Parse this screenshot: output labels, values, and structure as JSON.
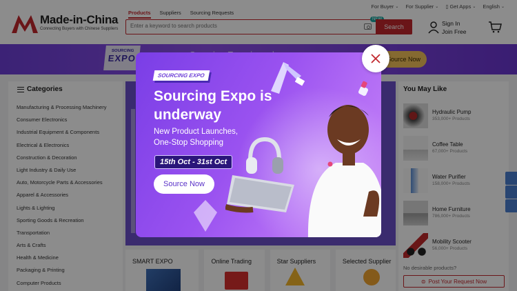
{
  "header": {
    "logo_title": "Made-in-China",
    "logo_subtitle": "Connecting Buyers with Chinese Suppliers",
    "topnav": [
      "For Buyer",
      "For Supplier",
      "Get Apps",
      "English"
    ],
    "search_tabs": [
      "Products",
      "Suppliers",
      "Sourcing Requests"
    ],
    "search_placeholder": "Enter a keyword to search products",
    "new_badge": "NEW",
    "search_button": "Search",
    "sign_in": "Sign In",
    "join_free": "Join Free",
    "brand_color": "#c1272d"
  },
  "banner": {
    "expo_logo_top": "SOURCING",
    "expo_logo_bottom": "EXPO",
    "title": "Sourcing Expo is underway",
    "cta": "Source Now"
  },
  "categories": {
    "title": "Categories",
    "items": [
      "Manufacturing & Processing Machinery",
      "Consumer Electronics",
      "Industrial Equipment & Components",
      "Electrical & Electronics",
      "Construction & Decoration",
      "Light Industry & Daily Use",
      "Auto, Motorcycle Parts & Accessories",
      "Apparel & Accessories",
      "Lights & Lighting",
      "Sporting Goods & Recreation",
      "Transportation",
      "Arts & Crafts",
      "Health & Medicine",
      "Packaging & Printing",
      "Computer Products"
    ]
  },
  "tiles": [
    "SMART EXPO",
    "Online Trading",
    "Star Suppliers",
    "Selected Supplier"
  ],
  "you_may_like": {
    "title": "You May Like",
    "items": [
      {
        "name": "Hydraulic Pump",
        "count": "353,000+ Products"
      },
      {
        "name": "Coffee Table",
        "count": "67,000+ Products"
      },
      {
        "name": "Water Purifier",
        "count": "158,000+ Products"
      },
      {
        "name": "Home Furniture",
        "count": "786,000+ Products"
      },
      {
        "name": "Mobility Scooter",
        "count": "56,000+ Products"
      }
    ],
    "no_desirable": "No desirable products?",
    "post_button": "Post Your Request Now"
  },
  "modal": {
    "badge": "SOURCING EXPO",
    "title": "Sourcing Expo is underway",
    "subtitle": "New Product Launches, One-Stop Shopping",
    "dates": "15th Oct - 31st Oct",
    "cta": "Source Now",
    "accent": "#7a3ee6"
  }
}
